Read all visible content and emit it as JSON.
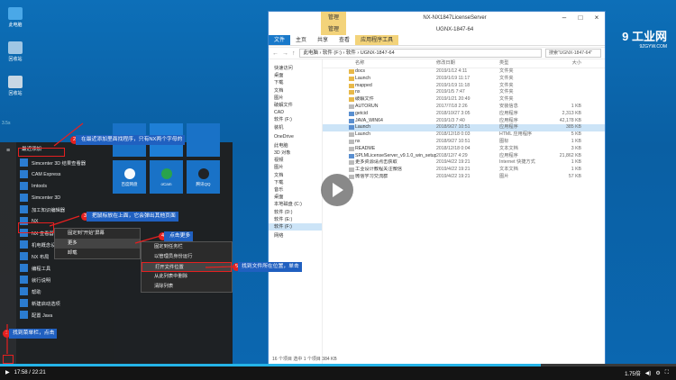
{
  "desktop": {
    "icons": [
      {
        "label": "此电脑",
        "icon": "computer-icon"
      },
      {
        "label": "回收站",
        "icon": "recycle-bin-icon"
      },
      {
        "label": "回收站",
        "icon": "recycle-bin-icon"
      }
    ],
    "side_text": "3.5s"
  },
  "explorer": {
    "context_tab": "管理",
    "title": "NX-NX1847LicenseServer",
    "context_tab2": "管理",
    "title2": "UGNX-1847-64",
    "ribbon": [
      "文件",
      "主页",
      "共享",
      "查看",
      "应用程序工具"
    ],
    "path": "此电脑 › 软件 (F:) › 软件 › UGNX-1847-64",
    "search_placeholder": "搜索\"UGNX-1847-64\"",
    "nav": [
      {
        "label": "快速访问",
        "group": true
      },
      {
        "label": "桌面"
      },
      {
        "label": "下载"
      },
      {
        "label": "文档"
      },
      {
        "label": "图片"
      },
      {
        "label": "破解文件"
      },
      {
        "label": "CAD"
      },
      {
        "label": "软件 (F:)"
      },
      {
        "label": "装机"
      },
      {
        "label": "OneDrive",
        "group": true
      },
      {
        "label": "此电脑",
        "group": true
      },
      {
        "label": "3D 对象"
      },
      {
        "label": "视频"
      },
      {
        "label": "图片"
      },
      {
        "label": "文档"
      },
      {
        "label": "下载"
      },
      {
        "label": "音乐"
      },
      {
        "label": "桌面"
      },
      {
        "label": "本地磁盘 (C:)"
      },
      {
        "label": "软件 (D:)"
      },
      {
        "label": "软件 (E:)"
      },
      {
        "label": "软件 (F:)",
        "selected": true
      },
      {
        "label": "网络",
        "group": true
      }
    ],
    "headers": [
      "名称",
      "修改日期",
      "类型",
      "大小"
    ],
    "files": [
      {
        "name": "docs",
        "date": "2019/1/12 4:11",
        "type": "文件夹",
        "size": "",
        "icon": "folder-icon"
      },
      {
        "name": "Launch",
        "date": "2019/1/19 11:17",
        "type": "文件夹",
        "size": "",
        "icon": "folder-icon"
      },
      {
        "name": "mapped",
        "date": "2019/1/19 11:18",
        "type": "文件夹",
        "size": "",
        "icon": "folder-icon"
      },
      {
        "name": "nx",
        "date": "2019/1/5 7:47",
        "type": "文件夹",
        "size": "",
        "icon": "folder-icon"
      },
      {
        "name": "破解文件",
        "date": "2019/1/21 20:49",
        "type": "文件夹",
        "size": "",
        "icon": "folder-icon"
      },
      {
        "name": "AUTORUN",
        "date": "2017/7/18 2:26",
        "type": "安装信息",
        "size": "1 KB",
        "icon": "file-icon"
      },
      {
        "name": "getcid",
        "date": "2018/10/27 3:05",
        "type": "应用程序",
        "size": "2,313 KB",
        "icon": "exe-icon"
      },
      {
        "name": "JAVA_WIN64",
        "date": "2019/1/3 7:40",
        "type": "应用程序",
        "size": "42,178 KB",
        "icon": "exe-icon"
      },
      {
        "name": "Launch",
        "date": "2018/9/27 10:51",
        "type": "应用程序",
        "size": "385 KB",
        "icon": "exe-icon",
        "selected": true
      },
      {
        "name": "Launch",
        "date": "2018/12/18 0:03",
        "type": "HTML 应用程序",
        "size": "5 KB",
        "icon": "file-icon"
      },
      {
        "name": "nx",
        "date": "2018/9/27 10:51",
        "type": "图标",
        "size": "1 KB",
        "icon": "file-icon"
      },
      {
        "name": "README",
        "date": "2018/12/18 0:04",
        "type": "文本文档",
        "size": "3 KB",
        "icon": "file-icon"
      },
      {
        "name": "SPLMLicenseServer_v9.1.0_win_setup",
        "date": "2018/12/7 4:29",
        "type": "应用程序",
        "size": "21,862 KB",
        "icon": "exe-icon"
      },
      {
        "name": "更多资源请点击获取",
        "date": "2019/4/22 19:21",
        "type": "Internet 快捷方式",
        "size": "1 KB",
        "icon": "file-icon"
      },
      {
        "name": "工业设计教程关注微信",
        "date": "2019/4/22 19:21",
        "type": "文本文档",
        "size": "1 KB",
        "icon": "file-icon"
      },
      {
        "name": "微信学习交流群",
        "date": "2019/4/22 19:21",
        "type": "图片",
        "size": "57 KB",
        "icon": "file-icon"
      }
    ],
    "status": "16 个项目   选中 1 个项目 384 KB"
  },
  "startmenu": {
    "header": "最近添加",
    "items": [
      "Simcenter 3D 结果查看器",
      "CAM Express",
      "Imtools",
      "Simcenter 3D",
      "加工知识编辑器",
      "NX",
      "NX 查看器",
      "机电概念设计",
      "NX 布局",
      "编程工具",
      "就行说明",
      "帮助",
      "新建启动选项",
      "配置 Java"
    ],
    "tiles": [
      {
        "label": "百度网盘",
        "icon": "baidu-netdisk-icon"
      },
      {
        "label": "oCam",
        "icon": "ocam-icon"
      },
      {
        "label": "腾讯QQ",
        "icon": "qq-icon"
      }
    ]
  },
  "context1": {
    "items": [
      "固定到\"开始\"屏幕",
      "更多",
      "卸载"
    ]
  },
  "context2": {
    "items": [
      "固定到任务栏",
      "以管理员身份运行",
      "打开文件位置",
      "从此列表中删除",
      "清除列表"
    ]
  },
  "annotations": [
    {
      "num": "1",
      "text": "找到菜单栏，点击"
    },
    {
      "num": "2",
      "text": "在最近添加里面找程序，只有NX两个字母的"
    },
    {
      "num": "3",
      "text": "把鼠标放在上面，它会弹出其他页面"
    },
    {
      "num": "4",
      "text": "点击更多"
    },
    {
      "num": "5",
      "text": "找到文件所在位置，单击"
    }
  ],
  "watermark": {
    "brand": "9 工业网",
    "url": "9ZGYW.COM"
  },
  "player": {
    "time": "17:58 / 22:21",
    "speed": "1.75倍",
    "progress": 0.8
  }
}
